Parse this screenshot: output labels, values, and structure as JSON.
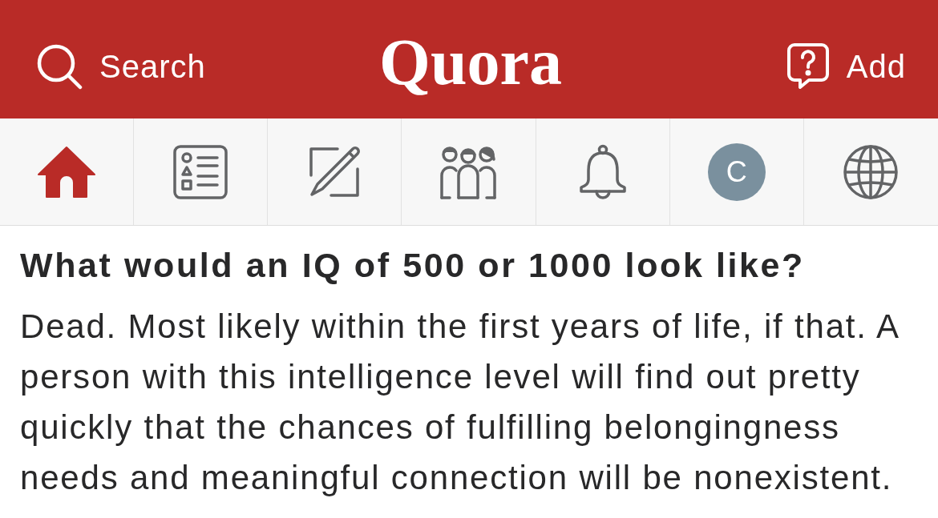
{
  "header": {
    "search": {
      "label": "Search"
    },
    "logo": "Quora",
    "add": {
      "label": "Add"
    }
  },
  "tabs": [
    {
      "kind": "home",
      "selected": true
    },
    {
      "kind": "answer",
      "selected": false
    },
    {
      "kind": "write",
      "selected": false
    },
    {
      "kind": "spaces",
      "selected": false
    },
    {
      "kind": "notifications",
      "selected": false
    },
    {
      "kind": "profile",
      "selected": false,
      "initial": "C"
    },
    {
      "kind": "languages",
      "selected": false
    }
  ],
  "question": {
    "title": "What would an IQ of 500 or 1000 look like?",
    "answer": "Dead. Most likely within the first years of life, if that. A person with this intelligence level will find out pretty quickly that the chances of fulfilling belongingness needs and meaningful connection will be nonexistent."
  }
}
